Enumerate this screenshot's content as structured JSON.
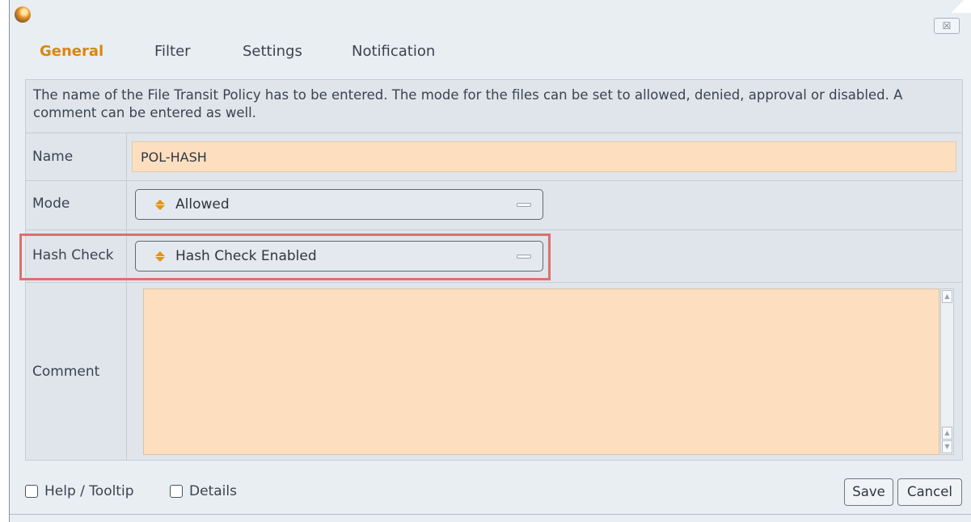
{
  "window": {
    "close_label": "☒"
  },
  "tabs": [
    {
      "label": "General",
      "active": true
    },
    {
      "label": "Filter",
      "active": false
    },
    {
      "label": "Settings",
      "active": false
    },
    {
      "label": "Notification",
      "active": false
    }
  ],
  "description": "The name of the File Transit Policy has to be entered. The mode for the files can be set to allowed, denied, approval or disabled. A comment can be entered as well.",
  "form": {
    "name": {
      "label": "Name",
      "value": "POL-HASH"
    },
    "mode": {
      "label": "Mode",
      "value": "Allowed"
    },
    "hash_check": {
      "label": "Hash Check",
      "value": "Hash Check Enabled"
    },
    "comment": {
      "label": "Comment",
      "value": ""
    }
  },
  "footer": {
    "help_label": "Help / Tooltip",
    "details_label": "Details",
    "save_label": "Save",
    "cancel_label": "Cancel"
  },
  "colors": {
    "accent": "#d9860f",
    "field_bg": "#fddfbf",
    "highlight": "#e26d6d",
    "panel_bg": "#dfe5ea"
  }
}
